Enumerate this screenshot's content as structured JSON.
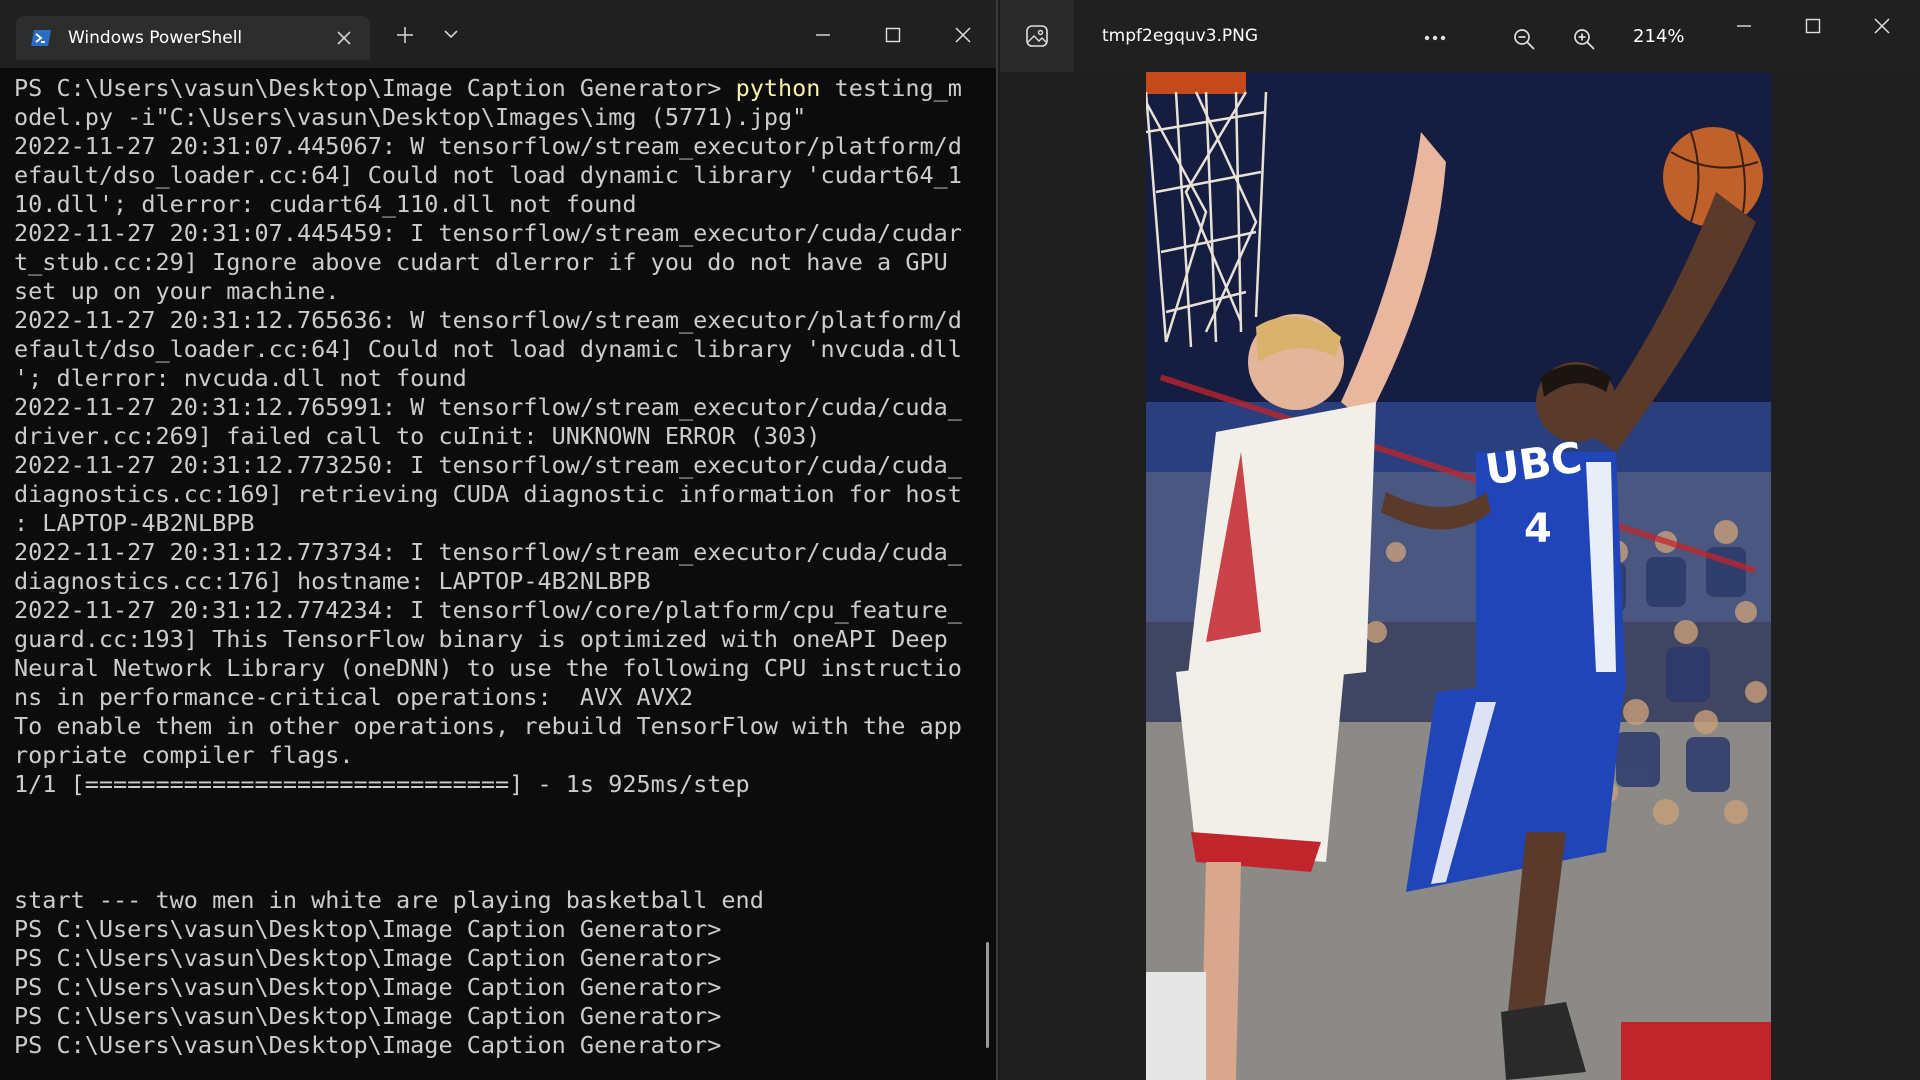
{
  "powershell": {
    "tab_title": "Windows PowerShell",
    "icons": {
      "tab": "powershell-icon",
      "close_tab": "close-icon",
      "new_tab": "plus-icon",
      "dropdown": "chevron-down-icon",
      "minimize": "minimize-icon",
      "maximize": "maximize-icon",
      "close": "close-icon"
    },
    "console": {
      "prompt_prefix": "PS C:\\Users\\vasun\\Desktop\\Image Caption Generator> ",
      "command_keyword": "python",
      "command_rest": " testing_m\nodel.py -i\"C:\\Users\\vasun\\Desktop\\Images\\img (5771).jpg\"",
      "output": "2022-11-27 20:31:07.445067: W tensorflow/stream_executor/platform/d\nefault/dso_loader.cc:64] Could not load dynamic library 'cudart64_1\n10.dll'; dlerror: cudart64_110.dll not found\n2022-11-27 20:31:07.445459: I tensorflow/stream_executor/cuda/cudar\nt_stub.cc:29] Ignore above cudart dlerror if you do not have a GPU\nset up on your machine.\n2022-11-27 20:31:12.765636: W tensorflow/stream_executor/platform/d\nefault/dso_loader.cc:64] Could not load dynamic library 'nvcuda.dll\n'; dlerror: nvcuda.dll not found\n2022-11-27 20:31:12.765991: W tensorflow/stream_executor/cuda/cuda_\ndriver.cc:269] failed call to cuInit: UNKNOWN ERROR (303)\n2022-11-27 20:31:12.773250: I tensorflow/stream_executor/cuda/cuda_\ndiagnostics.cc:169] retrieving CUDA diagnostic information for host\n: LAPTOP-4B2NLBPB\n2022-11-27 20:31:12.773734: I tensorflow/stream_executor/cuda/cuda_\ndiagnostics.cc:176] hostname: LAPTOP-4B2NLBPB\n2022-11-27 20:31:12.774234: I tensorflow/core/platform/cpu_feature_\nguard.cc:193] This TensorFlow binary is optimized with oneAPI Deep\nNeural Network Library (oneDNN) to use the following CPU instructio\nns in performance-critical operations:  AVX AVX2\nTo enable them in other operations, rebuild TensorFlow with the app\nropriate compiler flags.\n1/1 [==============================] - 1s 925ms/step\n\n\n\nstart --- two men in white are playing basketball end\nPS C:\\Users\\vasun\\Desktop\\Image Caption Generator>\nPS C:\\Users\\vasun\\Desktop\\Image Caption Generator>\nPS C:\\Users\\vasun\\Desktop\\Image Caption Generator>\nPS C:\\Users\\vasun\\Desktop\\Image Caption Generator>\nPS C:\\Users\\vasun\\Desktop\\Image Caption Generator>"
    }
  },
  "photos": {
    "filename": "tmpf2egquv3.PNG",
    "zoom_level": "214%",
    "image_text": {
      "jersey_team": "UBC",
      "jersey_number": "4"
    },
    "icons": {
      "app": "photos-app-icon",
      "more": "more-options-icon",
      "zoom_out": "zoom-out-icon",
      "zoom_in": "zoom-in-icon",
      "minimize": "minimize-icon",
      "maximize": "maximize-icon",
      "close": "close-icon"
    }
  },
  "colors": {
    "terminal_bg": "#0c0c0c",
    "terminal_text": "#cccccc",
    "command_highlight": "#f9f1a5",
    "titlebar_bg": "#202020",
    "jersey_blue": "#1f45b8",
    "jersey_red": "#c2242b"
  }
}
